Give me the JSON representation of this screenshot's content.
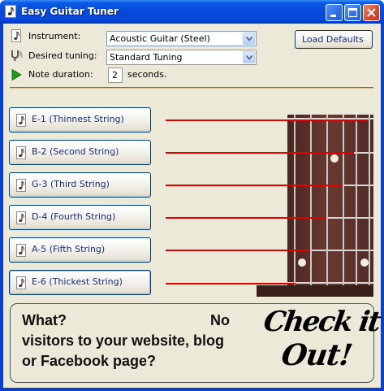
{
  "window": {
    "title": "Easy Guitar Tuner"
  },
  "settings": {
    "instrument_label": "Instrument:",
    "instrument_value": "Acoustic Guitar (Steel)",
    "tuning_label": "Desired tuning:",
    "tuning_value": "Standard Tuning",
    "duration_label": "Note duration:",
    "duration_value": "2",
    "duration_unit": "seconds.",
    "load_defaults_label": "Load Defaults"
  },
  "strings": [
    {
      "label": "E-1 (Thinnest String)"
    },
    {
      "label": "B-2 (Second String)"
    },
    {
      "label": "G-3 (Third String)"
    },
    {
      "label": "D-4 (Fourth String)"
    },
    {
      "label": "A-5 (Fifth String)"
    },
    {
      "label": "E-6 (Thickest String)"
    }
  ],
  "ad": {
    "line1_left": "What?",
    "line1_right": "No",
    "line2": "visitors to your website, blog",
    "line3": "or Facebook page?",
    "cta_line1": "Check it",
    "cta_line2": "Out!"
  },
  "colors": {
    "string_indicator": "#e00000",
    "fretboard": "#5a2f28",
    "title_bar": "#0a48dc"
  }
}
